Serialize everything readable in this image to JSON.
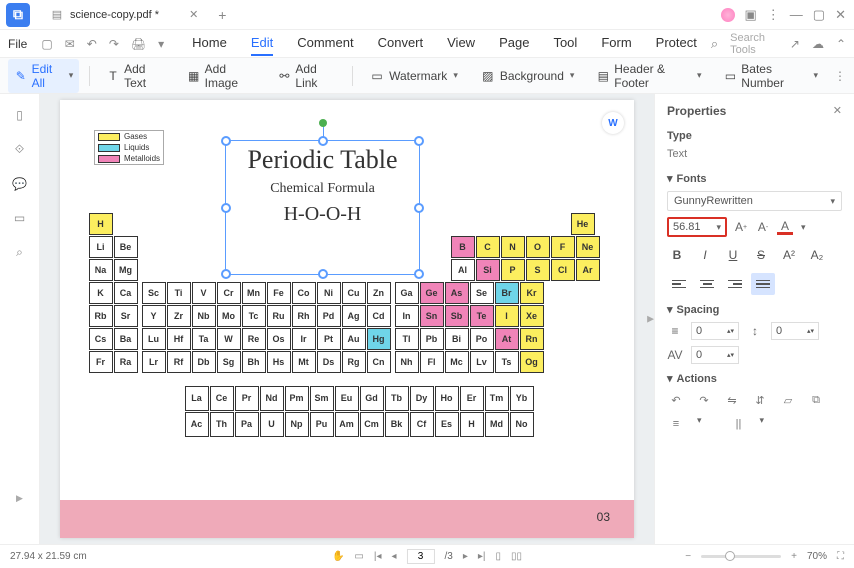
{
  "app": {
    "logo_letter": "⧉"
  },
  "tab": {
    "title": "science-copy.pdf *"
  },
  "window_controls": {
    "minimize": "—",
    "maximize": "▢",
    "close": "✕"
  },
  "file_menu": {
    "label": "File"
  },
  "quick_icons": {
    "save": "▢",
    "mail": "✉",
    "undo": "↶",
    "redo": "↷",
    "print": "🖨",
    "menu_caret": "▾"
  },
  "menu": {
    "home": "Home",
    "edit": "Edit",
    "comment": "Comment",
    "convert": "Convert",
    "view": "View",
    "page": "Page",
    "tool": "Tool",
    "form": "Form",
    "protect": "Protect"
  },
  "search": {
    "placeholder": "Search Tools"
  },
  "toolbar": {
    "edit_all": "Edit All",
    "add_text": "Add Text",
    "add_image": "Add Image",
    "add_link": "Add Link",
    "watermark": "Watermark",
    "background": "Background",
    "header_footer": "Header & Footer",
    "bates_number": "Bates Number"
  },
  "document": {
    "legend": {
      "gases": "Gases",
      "liquids": "Liquids",
      "metalloids": "Metalloids"
    },
    "title": "Periodic Table",
    "subtitle": "Chemical Formula",
    "formula": "H-O-O-H",
    "page_number": "03",
    "colors": {
      "gases": "#fcee5f",
      "liquids": "#6fd5e8",
      "metalloids": "#f084b8"
    },
    "elements": {
      "r1": [
        "H",
        "He"
      ],
      "r2": [
        "Li",
        "Be",
        "B",
        "C",
        "N",
        "O",
        "F",
        "Ne"
      ],
      "r3": [
        "Na",
        "Mg",
        "Al",
        "Si",
        "P",
        "S",
        "Cl",
        "Ar"
      ],
      "r4": [
        "K",
        "Ca",
        "Sc",
        "Ti",
        "V",
        "Cr",
        "Mn",
        "Fe",
        "Co",
        "Ni",
        "Cu",
        "Zn",
        "Ga",
        "Ge",
        "As",
        "Se",
        "Br",
        "Kr"
      ],
      "r5": [
        "Rb",
        "Sr",
        "Y",
        "Zr",
        "Nb",
        "Mo",
        "Tc",
        "Ru",
        "Rh",
        "Pd",
        "Ag",
        "Cd",
        "In",
        "Sn",
        "Sb",
        "Te",
        "I",
        "Xe"
      ],
      "r6": [
        "Cs",
        "Ba",
        "Lu",
        "Hf",
        "Ta",
        "W",
        "Re",
        "Os",
        "Ir",
        "Pt",
        "Au",
        "Hg",
        "Tl",
        "Pb",
        "Bi",
        "Po",
        "At",
        "Rn"
      ],
      "r7": [
        "Fr",
        "Ra",
        "Lr",
        "Rf",
        "Db",
        "Sg",
        "Bh",
        "Hs",
        "Mt",
        "Ds",
        "Rg",
        "Cn",
        "Nh",
        "Fl",
        "Mc",
        "Lv",
        "Ts",
        "Og"
      ],
      "l1": [
        "La",
        "Ce",
        "Pr",
        "Nd",
        "Pm",
        "Sm",
        "Eu",
        "Gd",
        "Tb",
        "Dy",
        "Ho",
        "Er",
        "Tm",
        "Yb"
      ],
      "l2": [
        "Ac",
        "Th",
        "Pa",
        "U",
        "Np",
        "Pu",
        "Am",
        "Cm",
        "Bk",
        "Cf",
        "Es",
        "H",
        "Md",
        "No"
      ]
    }
  },
  "properties": {
    "title": "Properties",
    "type_label": "Type",
    "type_value": "Text",
    "fonts_label": "Fonts",
    "font_name": "GunnyRewritten",
    "font_size": "56.81",
    "spacing_label": "Spacing",
    "line_spacing": "0",
    "para_spacing": "0",
    "char_spacing": "0",
    "actions_label": "Actions"
  },
  "status": {
    "dimensions": "27.94 x 21.59 cm",
    "page_current": "3",
    "page_total": "/3",
    "zoom": "70%"
  }
}
